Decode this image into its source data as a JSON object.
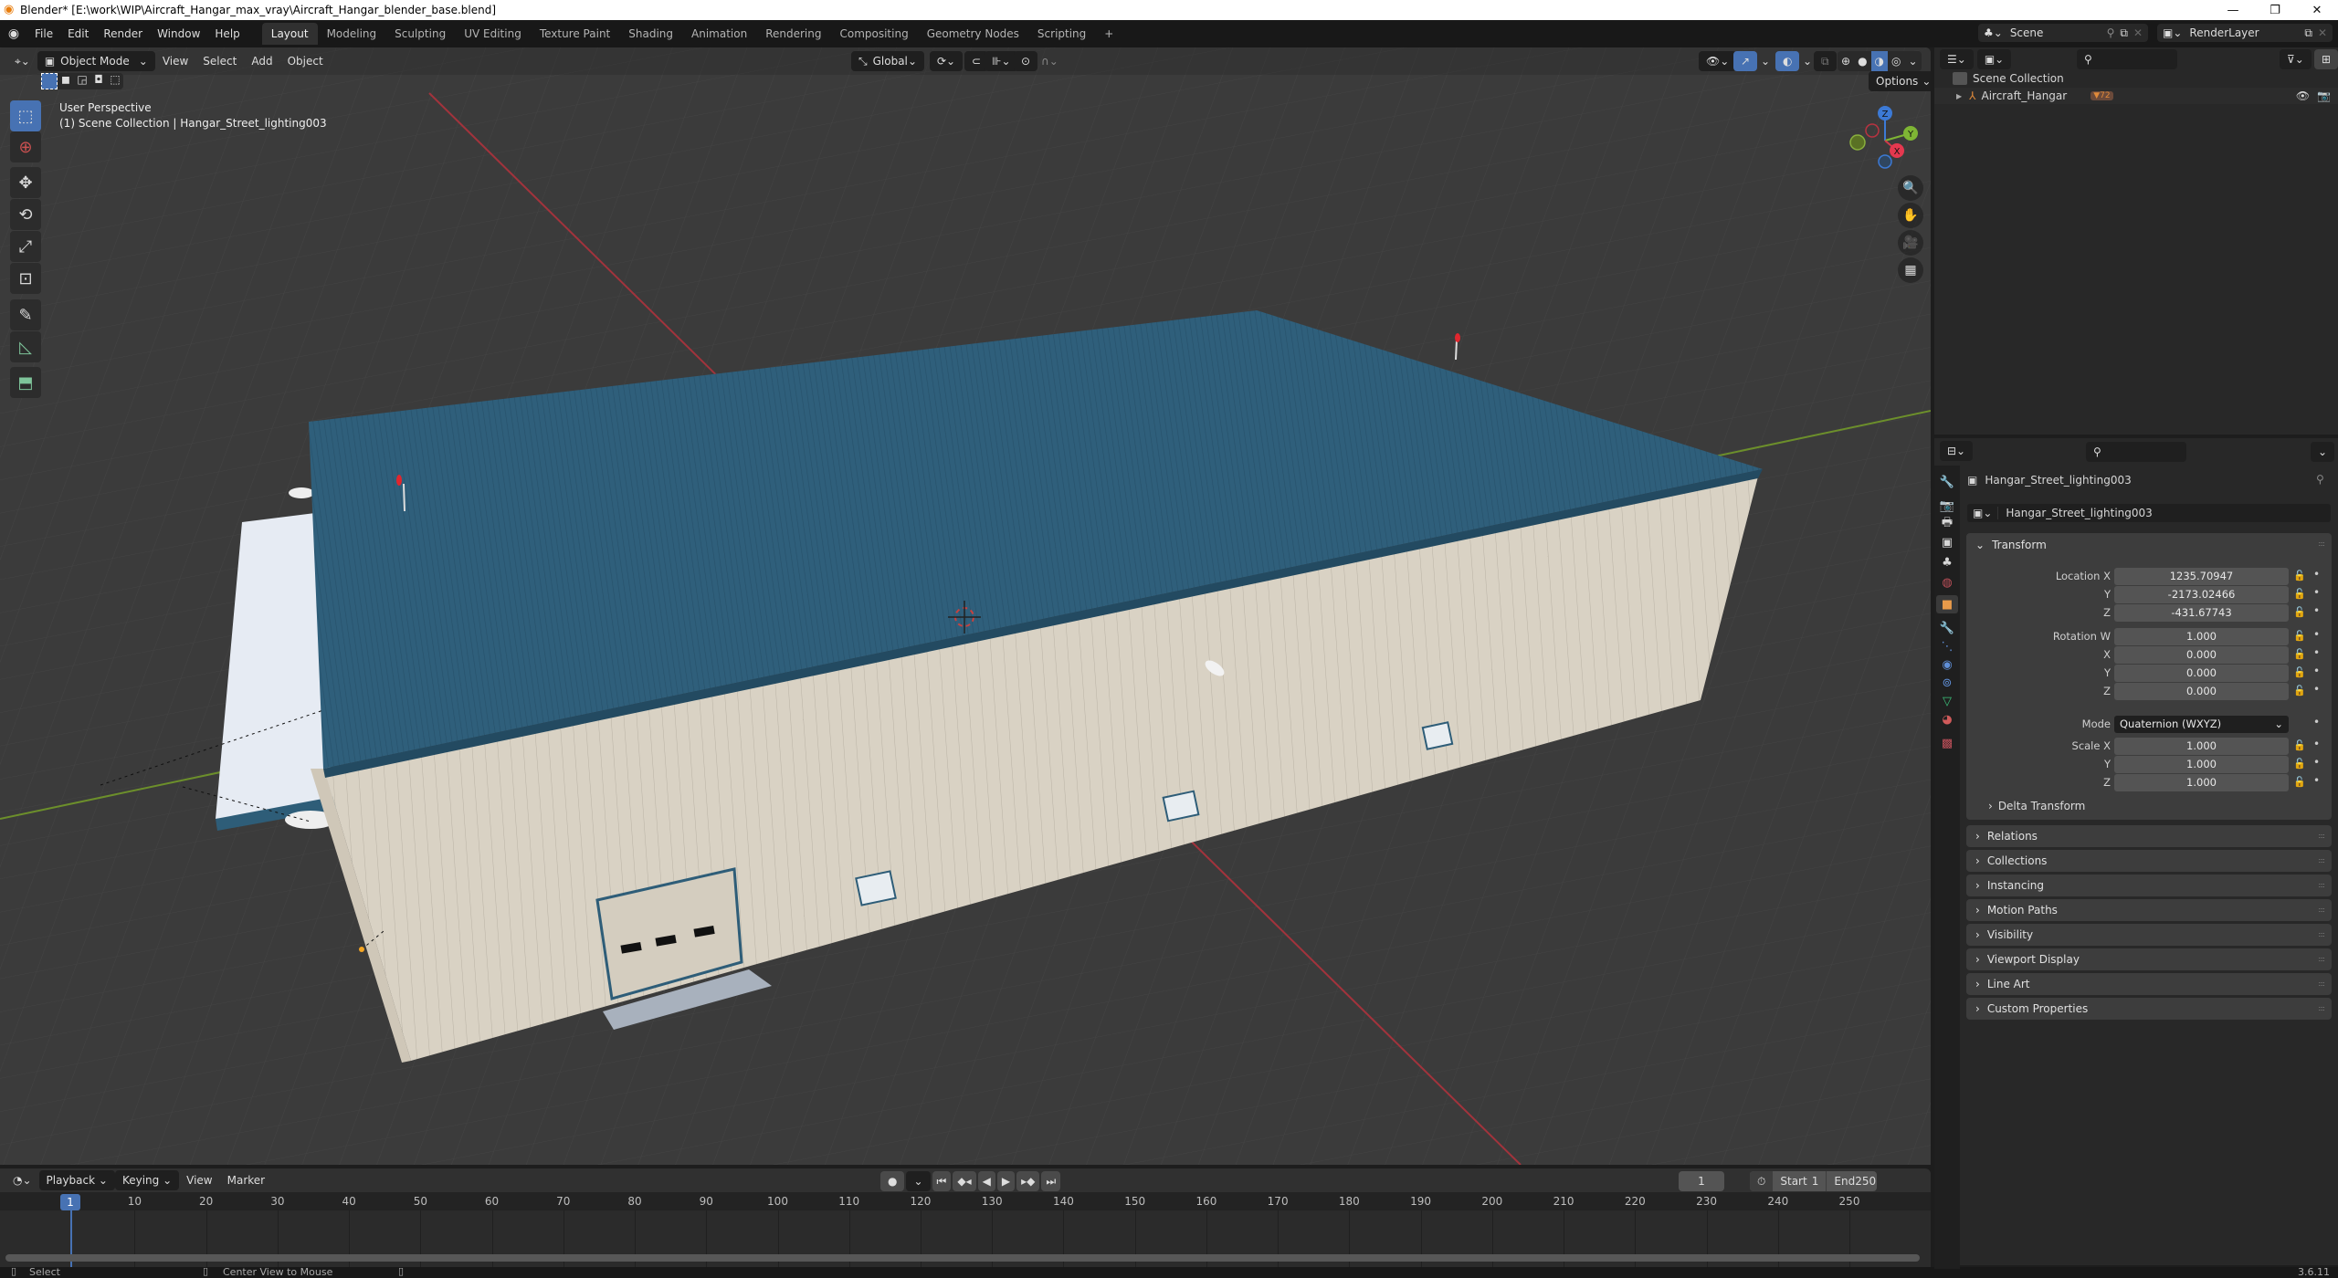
{
  "window": {
    "title": "Blender* [E:\\work\\WIP\\Aircraft_Hangar_max_vray\\Aircraft_Hangar_blender_base.blend]",
    "minimize": "—",
    "maximize": "❐",
    "close": "✕"
  },
  "menus": [
    "File",
    "Edit",
    "Render",
    "Window",
    "Help"
  ],
  "workspaces": [
    {
      "label": "Layout",
      "active": true
    },
    {
      "label": "Modeling"
    },
    {
      "label": "Sculpting"
    },
    {
      "label": "UV Editing"
    },
    {
      "label": "Texture Paint"
    },
    {
      "label": "Shading"
    },
    {
      "label": "Animation"
    },
    {
      "label": "Rendering"
    },
    {
      "label": "Compositing"
    },
    {
      "label": "Geometry Nodes"
    },
    {
      "label": "Scripting"
    }
  ],
  "add_workspace": "+",
  "scene_selector": {
    "label": "Scene"
  },
  "view_layer_selector": {
    "label": "RenderLayer"
  },
  "viewport": {
    "mode": "Object Mode",
    "menus": [
      "View",
      "Select",
      "Add",
      "Object"
    ],
    "transform_orientation": "Global",
    "options_label": "Options",
    "overlay_title": "User Perspective",
    "overlay_subtitle": "(1) Scene Collection | Hangar_Street_lighting003",
    "gizmo": {
      "z": "Z",
      "y": "Y",
      "x": "X"
    },
    "colors": {
      "roof": "#2e5d78",
      "wall": "#d7d0c3",
      "x_axis": "#b83340",
      "y_axis": "#7ea832",
      "active_blue": "#4772b3"
    }
  },
  "toolbar": {
    "tools": [
      "select-box",
      "cursor",
      "move",
      "rotate",
      "scale",
      "transform",
      "annotate",
      "measure",
      "add-cube"
    ]
  },
  "outliner": {
    "root": "Scene Collection",
    "items": [
      {
        "name": "Aircraft_Hangar",
        "badge": "72"
      }
    ]
  },
  "properties": {
    "object_name": "Hangar_Street_lighting003",
    "datablock_name": "Hangar_Street_lighting003",
    "transform": {
      "title": "Transform",
      "location": {
        "label": "Location X",
        "x": "1235.70947",
        "y": "-2173.02466",
        "z": "-431.67743"
      },
      "rotation": {
        "label": "Rotation W",
        "w": "1.000",
        "x": "0.000",
        "y": "0.000",
        "z": "0.000"
      },
      "mode_label": "Mode",
      "mode_value": "Quaternion (WXYZ)",
      "scale": {
        "label": "Scale X",
        "x": "1.000",
        "y": "1.000",
        "z": "1.000"
      },
      "axis_labels": {
        "x": "X",
        "y": "Y",
        "z": "Z"
      },
      "delta": "Delta Transform"
    },
    "panels": [
      "Relations",
      "Collections",
      "Instancing",
      "Motion Paths",
      "Visibility",
      "Viewport Display",
      "Line Art",
      "Custom Properties"
    ]
  },
  "timeline": {
    "menus": [
      "Playback",
      "Keying",
      "View",
      "Marker"
    ],
    "current_frame": "1",
    "start_label": "Start",
    "start": "1",
    "end_label": "End",
    "end": "250",
    "ticks": [
      "10",
      "20",
      "30",
      "40",
      "50",
      "60",
      "70",
      "80",
      "90",
      "100",
      "110",
      "120",
      "130",
      "140",
      "150",
      "160",
      "170",
      "180",
      "190",
      "200",
      "210",
      "220",
      "230",
      "240",
      "250"
    ]
  },
  "statusbar": {
    "select": "Select",
    "center_view": "Center View to Mouse",
    "version": "3.6.11"
  }
}
